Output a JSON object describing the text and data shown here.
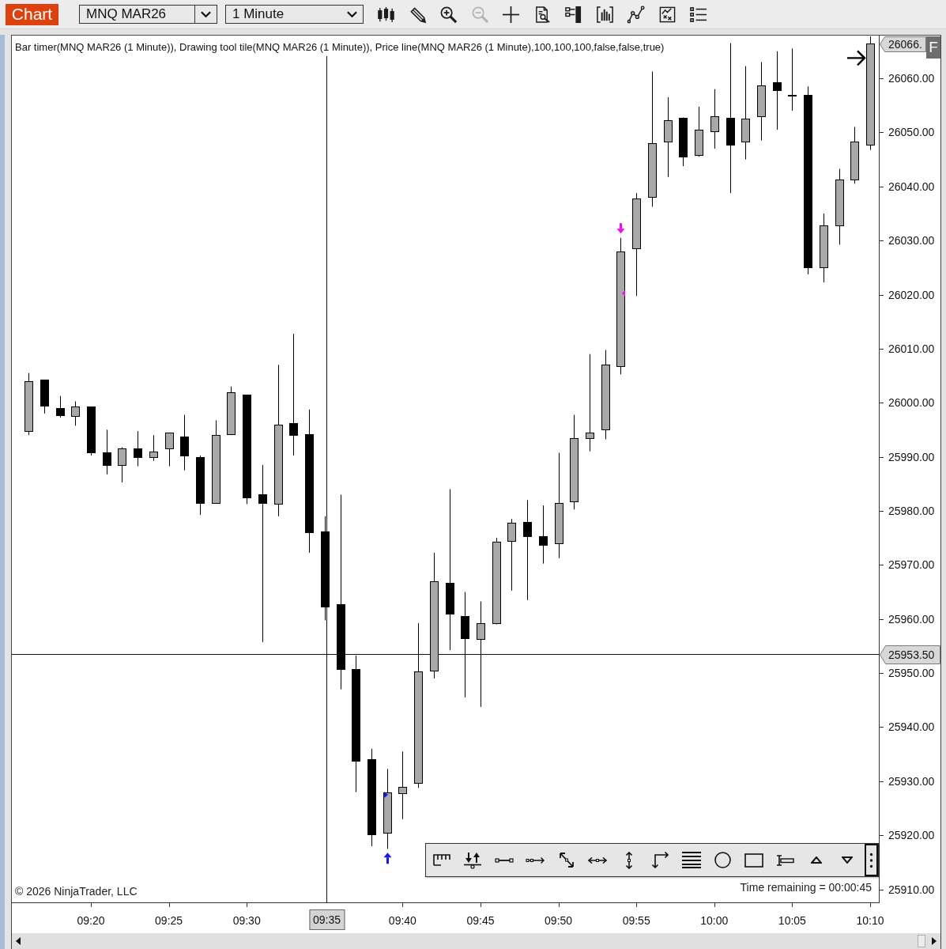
{
  "window": {
    "title": "Chart"
  },
  "toolbar": {
    "instrument": {
      "value": "MNQ MAR26"
    },
    "interval": {
      "value": "1 Minute"
    },
    "buttons": [
      {
        "kind": "chart-style",
        "disabled": false
      },
      {
        "kind": "drawing-tools",
        "disabled": false
      },
      {
        "kind": "zoom-in",
        "disabled": false
      },
      {
        "kind": "zoom-out",
        "disabled": true
      },
      {
        "kind": "crosshair",
        "disabled": false
      },
      {
        "kind": "data-box",
        "disabled": false
      },
      {
        "kind": "chart-trader",
        "disabled": false
      },
      {
        "kind": "indicators",
        "disabled": false
      },
      {
        "kind": "strategies",
        "disabled": false
      },
      {
        "kind": "templates",
        "disabled": false
      },
      {
        "kind": "properties",
        "disabled": false
      }
    ]
  },
  "chart": {
    "legend": "Bar timer(MNQ MAR26 (1 Minute)), Drawing tool tile(MNQ MAR26 (1 Minute)), Price line(MNQ MAR26 (1 Minute),100,100,100,false,false,true)",
    "copyright": "© 2026 NinjaTrader, LLC",
    "bar_timer": "Time remaining = 00:00:45",
    "last_price_label": "26066.",
    "position_flag": "F",
    "crosshair": {
      "price_label": "25953.50",
      "time_label": "09:35"
    },
    "chart_data": {
      "type": "candlestick",
      "categories": [
        null,
        null,
        null,
        null,
        "09:20",
        null,
        null,
        null,
        null,
        "09:25",
        null,
        null,
        null,
        null,
        "09:30",
        null,
        null,
        null,
        null,
        null,
        null,
        null,
        null,
        null,
        "09:40",
        null,
        null,
        null,
        null,
        "09:45",
        null,
        null,
        null,
        null,
        "09:50",
        null,
        null,
        null,
        null,
        "09:55",
        null,
        null,
        null,
        null,
        "10:00",
        null,
        null,
        null,
        null,
        "10:05",
        null,
        null,
        null,
        null,
        "10:10"
      ],
      "ohlc": [
        [
          25994.75,
          26005.5,
          25994.0,
          26004.0
        ],
        [
          26004.25,
          26004.25,
          25998.0,
          25999.5
        ],
        [
          25999.0,
          26001.25,
          25997.25,
          25997.75
        ],
        [
          25997.5,
          26000.25,
          25995.75,
          25999.25
        ],
        [
          25999.25,
          25999.25,
          25990.25,
          25990.75
        ],
        [
          25990.75,
          25995.0,
          25986.75,
          25988.5
        ],
        [
          25988.5,
          25991.75,
          25985.25,
          25991.5
        ],
        [
          25991.5,
          25994.75,
          25988.25,
          25990.0
        ],
        [
          25990.0,
          25994.0,
          25989.25,
          25991.0
        ],
        [
          25991.5,
          25994.5,
          25988.25,
          25994.5
        ],
        [
          25993.75,
          25997.75,
          25987.5,
          25990.25
        ],
        [
          25990.0,
          25990.25,
          25979.25,
          25981.5
        ],
        [
          25981.5,
          25996.75,
          25981.5,
          25994.0
        ],
        [
          25994.25,
          26003.0,
          25994.0,
          26002.0
        ],
        [
          26001.5,
          26001.5,
          25981.25,
          25982.5
        ],
        [
          25983.0,
          25988.5,
          25955.75,
          25981.5
        ],
        [
          25981.25,
          26007.0,
          25979.0,
          25996.0
        ],
        [
          25996.25,
          26012.75,
          25990.25,
          25994.0
        ],
        [
          25994.25,
          25998.75,
          25972.25,
          25976.0
        ],
        [
          25976.25,
          25979.0,
          25959.75,
          25962.25
        ],
        [
          25962.75,
          25983.0,
          25947.0,
          25950.75
        ],
        [
          25950.75,
          25953.25,
          25928.0,
          25933.75
        ],
        [
          25934.0,
          25936.0,
          25918.0,
          25920.25
        ],
        [
          25920.5,
          25932.25,
          25917.5,
          25928.0
        ],
        [
          25927.75,
          25935.5,
          25923.0,
          25929.0
        ],
        [
          25929.75,
          25959.25,
          25928.75,
          25950.25
        ],
        [
          25950.5,
          25972.25,
          25949.0,
          25967.0
        ],
        [
          25966.75,
          25984.0,
          25954.25,
          25961.0
        ],
        [
          25960.5,
          25965.0,
          25945.5,
          25956.5
        ],
        [
          25956.25,
          25963.25,
          25943.75,
          25959.25
        ],
        [
          25959.25,
          25975.0,
          25959.0,
          25974.25
        ],
        [
          25974.5,
          25978.5,
          25965.25,
          25977.75
        ],
        [
          25978.0,
          25982.0,
          25963.5,
          25975.25
        ],
        [
          25975.25,
          25981.0,
          25970.25,
          25973.75
        ],
        [
          25974.0,
          25990.75,
          25971.25,
          25981.5
        ],
        [
          25981.75,
          25997.75,
          25980.25,
          25993.5
        ],
        [
          25993.5,
          26009.0,
          25991.0,
          25994.5
        ],
        [
          25995.0,
          26009.75,
          25993.25,
          26007.0
        ],
        [
          26006.75,
          26030.5,
          26005.25,
          26028.0
        ],
        [
          26028.5,
          26038.75,
          26019.75,
          26037.75
        ],
        [
          26038.0,
          26061.25,
          26036.25,
          26048.0
        ],
        [
          26048.25,
          26056.5,
          26041.75,
          26052.25
        ],
        [
          26052.75,
          26052.75,
          26043.75,
          26045.5
        ],
        [
          26045.75,
          26054.75,
          26045.5,
          26050.5
        ],
        [
          26050.25,
          26058.0,
          26047.0,
          26053.0
        ],
        [
          26052.75,
          26066.5,
          26038.75,
          26047.75
        ],
        [
          26048.25,
          26062.25,
          26045.0,
          26052.5
        ],
        [
          26053.0,
          26063.0,
          26048.5,
          26058.75
        ],
        [
          26059.25,
          26065.0,
          26050.5,
          26057.75
        ],
        [
          26056.75,
          26065.5,
          26054.0,
          26057.0
        ],
        [
          26057.0,
          26058.5,
          26023.75,
          26025.0
        ],
        [
          26025.0,
          26035.0,
          26022.25,
          26032.75
        ],
        [
          26032.75,
          26043.25,
          26029.25,
          26041.25
        ],
        [
          26041.25,
          26051.0,
          26040.5,
          26048.25
        ],
        [
          26047.75,
          26067.75,
          26046.75,
          26066.5
        ]
      ],
      "ylim": [
        25907.6,
        26067.9
      ],
      "yticks": [
        {
          "value": 26060,
          "label": "26060.00"
        },
        {
          "value": 26050,
          "label": "26050.00"
        },
        {
          "value": 26040,
          "label": "26040.00"
        },
        {
          "value": 26030,
          "label": "26030.00"
        },
        {
          "value": 26020,
          "label": "26020.00"
        },
        {
          "value": 26010,
          "label": "26010.00"
        },
        {
          "value": 26000,
          "label": "26000.00"
        },
        {
          "value": 25990,
          "label": "25990.00"
        },
        {
          "value": 25980,
          "label": "25980.00"
        },
        {
          "value": 25970,
          "label": "25970.00"
        },
        {
          "value": 25960,
          "label": "25960.00"
        },
        {
          "value": 25950,
          "label": "25950.00"
        },
        {
          "value": 25940,
          "label": "25940.00"
        },
        {
          "value": 25930,
          "label": "25930.00"
        },
        {
          "value": 25920,
          "label": "25920.00"
        },
        {
          "value": 25910,
          "label": "25910.00"
        }
      ]
    }
  },
  "drawing_tools": [
    {
      "kind": "ruler"
    },
    {
      "kind": "risk-reward"
    },
    {
      "kind": "line"
    },
    {
      "kind": "ray"
    },
    {
      "kind": "arrow-line"
    },
    {
      "kind": "extended-line"
    },
    {
      "kind": "vertical-line"
    },
    {
      "kind": "path"
    },
    {
      "kind": "lines"
    },
    {
      "kind": "ellipse"
    },
    {
      "kind": "rectangle"
    },
    {
      "kind": "text"
    },
    {
      "kind": "arrow-up"
    },
    {
      "kind": "arrow-down"
    }
  ]
}
